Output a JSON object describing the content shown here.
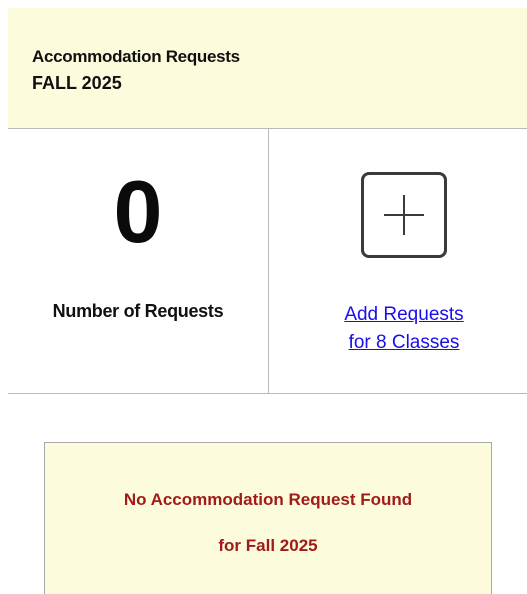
{
  "header": {
    "title": "Accommodation Requests",
    "term": "FALL 2025"
  },
  "summary": {
    "count": "0",
    "count_label": "Number of Requests"
  },
  "add": {
    "icon": "plus-icon",
    "link_line1": "Add Requests",
    "link_line2": "for 8 Classes"
  },
  "notice": {
    "line1": "No Accommodation Request Found",
    "line2": "for Fall 2025"
  },
  "colors": {
    "header_bg": "#fcfbdc",
    "link": "#1a0dee",
    "notice_text": "#a11b1b"
  }
}
